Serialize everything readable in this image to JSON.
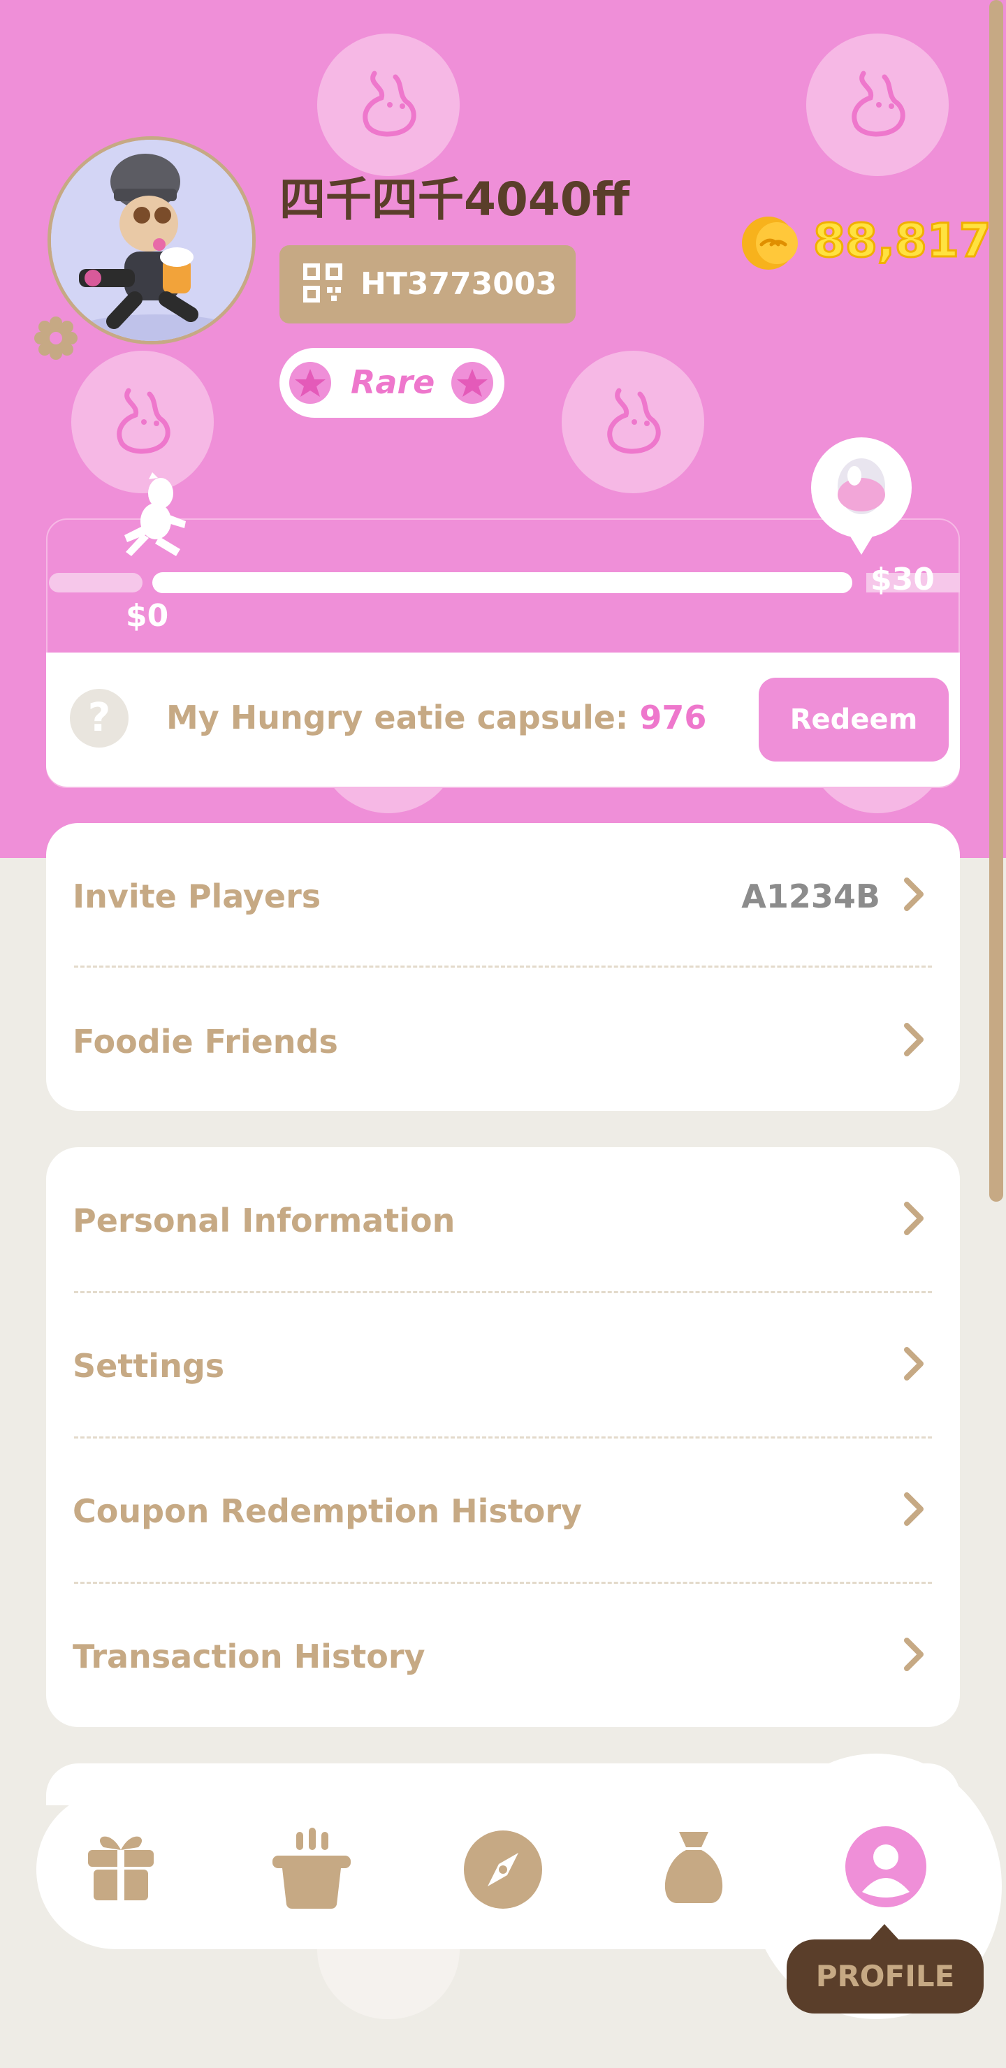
{
  "profile": {
    "username": "四千四千4040ff",
    "player_id": "HT3773003",
    "rank": "Rare",
    "coins": "88,817"
  },
  "progress": {
    "start_label": "$0",
    "end_label": "$30",
    "fill_fraction": 0.98
  },
  "capsule": {
    "label": "My Hungry eatie capsule:",
    "count": "976",
    "redeem_label": "Redeem"
  },
  "menu_group_1": {
    "invite_label": "Invite Players",
    "invite_code": "A1234B",
    "friends_label": "Foodie Friends"
  },
  "menu_group_2": {
    "personal_label": "Personal Information",
    "settings_label": "Settings",
    "coupon_label": "Coupon Redemption History",
    "transaction_label": "Transaction History"
  },
  "nav": {
    "items": [
      "gift-icon",
      "pot-icon",
      "compass-icon",
      "bag-icon",
      "profile-icon"
    ],
    "active_label": "PROFILE"
  },
  "colors": {
    "primary_pink": "#EF8FD8",
    "tan": "#C6A984",
    "brown": "#5A3E2A",
    "background": "#EEECE6"
  }
}
